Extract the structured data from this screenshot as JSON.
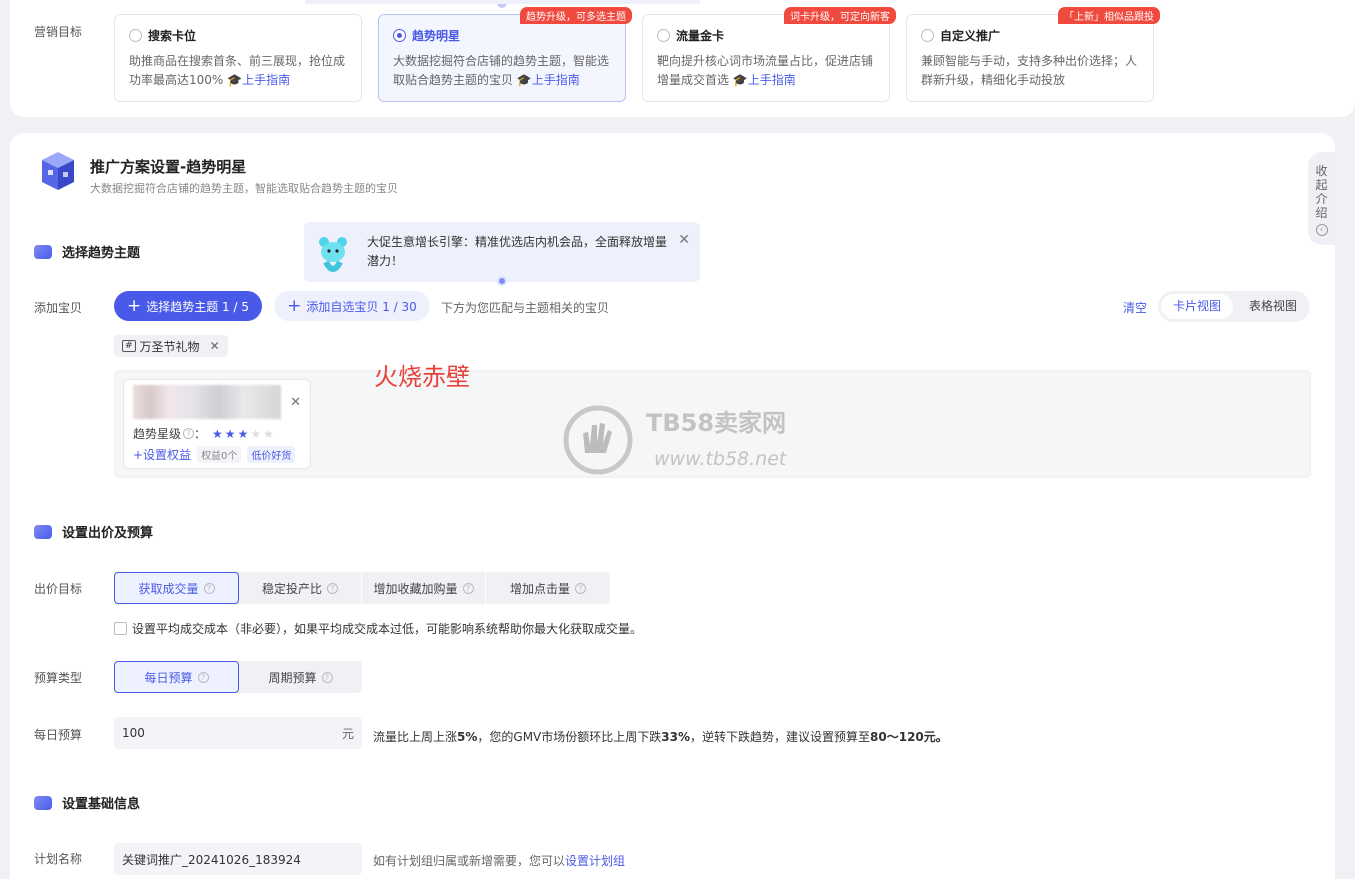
{
  "marketing": {
    "label": "营销目标",
    "goals": [
      {
        "title": "搜索卡位",
        "desc": "助推商品在搜索首条、前三展现，抢位成功率最高达100%",
        "guide": "上手指南",
        "tag": "",
        "selected": false
      },
      {
        "title": "趋势明星",
        "desc": "大数据挖掘符合店铺的趋势主题，智能选取贴合趋势主题的宝贝",
        "guide": "上手指南",
        "tag": "趋势升级，可多选主题",
        "selected": true
      },
      {
        "title": "流量金卡",
        "desc": "靶向提升核心词市场流量占比，促进店铺增量成交首选",
        "guide": "上手指南",
        "tag": "词卡升级，可定向新客",
        "selected": false
      },
      {
        "title": "自定义推广",
        "desc": "兼顾智能与手动，支持多种出价选择；人群新升级，精细化手动投放",
        "guide": "",
        "tag": "「上新」相似品跟投",
        "selected": false
      }
    ]
  },
  "plan": {
    "title": "推广方案设置-趋势明星",
    "subtitle": "大数据挖掘符合店铺的趋势主题，智能选取贴合趋势主题的宝贝",
    "collapse_label": "收起介绍"
  },
  "trend": {
    "section_title": "选择趋势主题",
    "tooltip": "大促生意增长引擎：精准优选店内机会品，全面释放增量潜力！",
    "add_label": "添加宝贝",
    "select_btn": "选择趋势主题 1 / 5",
    "add_self_btn": "添加自选宝贝 1 / 30",
    "hint": "下方为您匹配与主题相关的宝贝",
    "clear": "清空",
    "view_card": "卡片视图",
    "view_table": "表格视图",
    "chip": "万圣节礼物",
    "watermark_red": "火烧赤壁",
    "watermark_brand": "TB58卖家网",
    "watermark_url": "www.tb58.net",
    "product": {
      "star_label": "趋势星级",
      "stars": 3,
      "stars_max": 5,
      "set_benefit": "+设置权益",
      "benefit_count": "权益0个",
      "badge": "低价好货"
    }
  },
  "bid": {
    "section_title": "设置出价及预算",
    "target_label": "出价目标",
    "targets": [
      "获取成交量",
      "稳定投产比",
      "增加收藏加购量",
      "增加点击量"
    ],
    "avg_cost_text": "设置平均成交成本（非必要），如果平均成交成本过低，可能影响系统帮助你最大化获取成交量。",
    "budget_type_label": "预算类型",
    "budget_types": [
      "每日预算",
      "周期预算"
    ],
    "daily_label": "每日预算",
    "daily_value": "100",
    "unit": "元",
    "advice_a": "流量比上周上涨",
    "advice_b": "5%",
    "advice_c": "，您的GMV市场份额环比上周下跌",
    "advice_d": "33%",
    "advice_e": "，逆转下跌趋势，建议设置预算至",
    "advice_f": "80～120元。"
  },
  "basic": {
    "section_title": "设置基础信息",
    "name_label": "计划名称",
    "name_value": "关键词推广_20241026_183924",
    "name_hint": "如有计划组归属或新增需要，您可以",
    "name_link": "设置计划组"
  }
}
